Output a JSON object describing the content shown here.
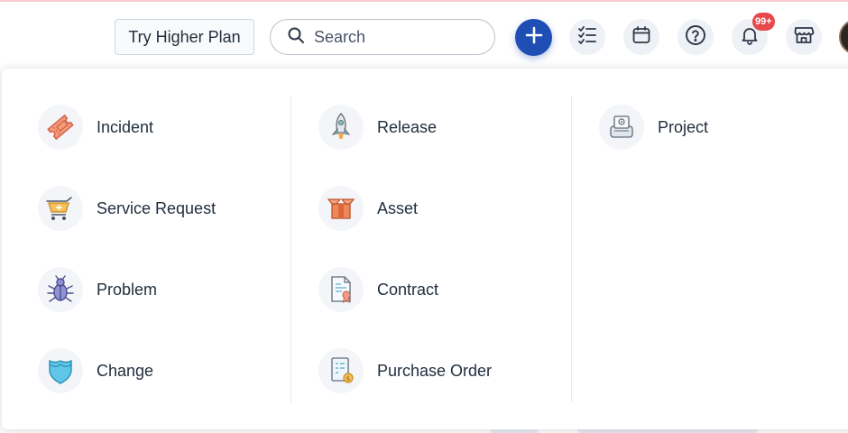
{
  "header": {
    "plan_button": "Try Higher Plan",
    "search_placeholder": "Search",
    "notifications_badge": "99+",
    "icons": [
      "add-icon",
      "tasks-checklist-icon",
      "calendar-icon",
      "help-icon",
      "notification-bell-icon",
      "marketplace-store-icon"
    ]
  },
  "new_menu": {
    "columns": [
      {
        "items": [
          {
            "label": "Incident",
            "icon": "ticket-icon"
          },
          {
            "label": "Service Request",
            "icon": "shopping-cart-icon"
          },
          {
            "label": "Problem",
            "icon": "bug-icon"
          },
          {
            "label": "Change",
            "icon": "shield-icon"
          }
        ]
      },
      {
        "items": [
          {
            "label": "Release",
            "icon": "rocket-icon"
          },
          {
            "label": "Asset",
            "icon": "box-icon"
          },
          {
            "label": "Contract",
            "icon": "contract-certificate-icon"
          },
          {
            "label": "Purchase Order",
            "icon": "purchase-order-icon"
          }
        ]
      },
      {
        "items": [
          {
            "label": "Project",
            "icon": "project-kanban-icon"
          }
        ]
      }
    ]
  },
  "colors": {
    "primary": "#1f4fb5",
    "badge": "#e5484d",
    "text": "#1f2d3d"
  }
}
